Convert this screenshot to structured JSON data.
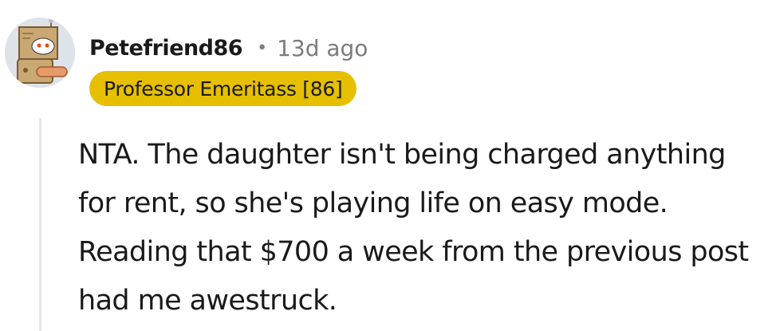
{
  "comment": {
    "username": "Petefriend86",
    "separator": "•",
    "timestamp": "13d ago",
    "flair": "Professor Emeritass [86]",
    "body": "NTA. The daughter isn't being charged anything for rent, so she's playing life on easy mode. Reading that $700 a week from the previous post had me awestruck."
  },
  "colors": {
    "flair_background": "#e6bf00",
    "username": "#1a1a1b",
    "timestamp": "#7c7c7c",
    "thread_line": "#e7e7e7"
  },
  "icons": {
    "avatar": "snoo-robot-avatar-icon"
  }
}
